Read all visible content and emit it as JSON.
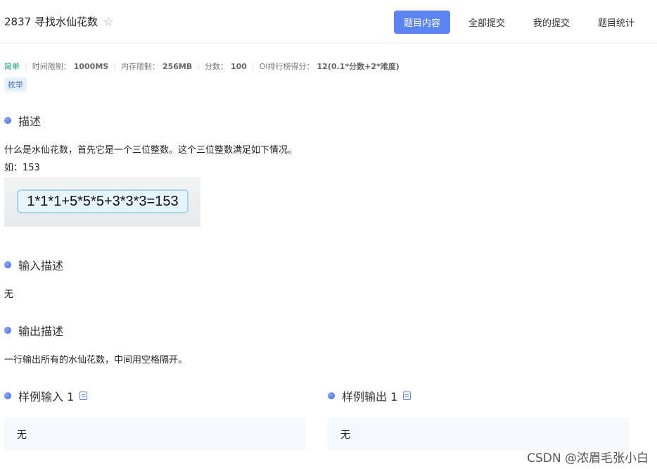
{
  "header": {
    "problem_title": "2837 寻找水仙花数",
    "tabs": [
      {
        "label": "题目内容",
        "active": true
      },
      {
        "label": "全部提交",
        "active": false
      },
      {
        "label": "我的提交",
        "active": false
      },
      {
        "label": "题目统计",
        "active": false
      }
    ]
  },
  "meta": {
    "difficulty": "简单",
    "time_limit_label": "时间限制：",
    "time_limit": "1000MS",
    "memory_limit_label": "内存限制：",
    "memory_limit": "256MB",
    "score_label": "分数：",
    "score": "100",
    "oi_label": "OI排行榜得分：",
    "oi_value": "12(0.1*分数+2*难度)",
    "tag": "枚举"
  },
  "description": {
    "title": "描述",
    "line1": "什么是水仙花数，首先它是一个三位整数。这个三位整数满足如下情况。",
    "line2": "如：153",
    "formula": "1*1*1+5*5*5+3*3*3=153"
  },
  "input_desc": {
    "title": "输入描述",
    "text": "无"
  },
  "output_desc": {
    "title": "输出描述",
    "text": "一行输出所有的水仙花数，中间用空格隔开。"
  },
  "samples": {
    "input_title": "样例输入 1",
    "input_value": "无",
    "output_title": "样例输出 1",
    "output_value": "无"
  },
  "watermark": "CSDN @浓眉毛张小白",
  "colors": {
    "accent": "#5b86f2",
    "easy": "#1aa37a",
    "tag_bg": "#e8efff"
  },
  "icons": [
    "star-icon",
    "section-dot-icon",
    "copy-icon"
  ]
}
